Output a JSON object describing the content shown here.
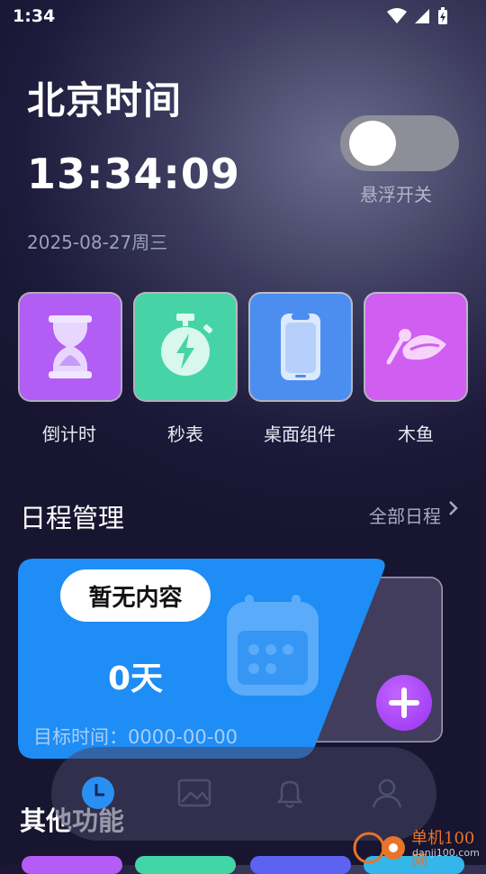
{
  "status_bar": {
    "time": "1:34"
  },
  "header": {
    "city_title": "北京时间",
    "clock": "13:34:09",
    "date": "2025-08-27周三",
    "float_toggle_label": "悬浮开关",
    "float_toggle_on": false
  },
  "tools": [
    {
      "label": "倒计时",
      "icon": "hourglass-icon",
      "color": "#b45cf5"
    },
    {
      "label": "秒表",
      "icon": "stopwatch-icon",
      "color": "#42d6a6"
    },
    {
      "label": "桌面组件",
      "icon": "phone-widget-icon",
      "color": "#4a8ff0"
    },
    {
      "label": "木鱼",
      "icon": "wooden-fish-icon",
      "color": "#d05ef0"
    }
  ],
  "schedule": {
    "title": "日程管理",
    "all_link": "全部日程",
    "empty_badge": "暂无内容",
    "days": "0天",
    "target_time": "目标时间：0000-00-00",
    "accent": "#1e8df5"
  },
  "other": {
    "title": "其他功能"
  },
  "watermark": {
    "line1": "单机100网",
    "line2": "danji100.com"
  },
  "nav": [
    "clock-icon",
    "gallery-icon",
    "bell-icon",
    "profile-icon"
  ]
}
